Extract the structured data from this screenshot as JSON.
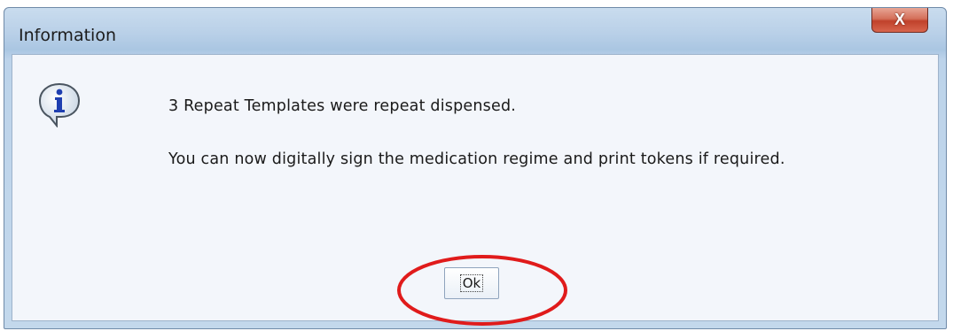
{
  "dialog": {
    "title": "Information",
    "close_icon": "close-icon",
    "close_label": "X",
    "icon": "information-icon",
    "message_line1": "3 Repeat Templates were repeat dispensed.",
    "message_line2": "You can now digitally sign the medication regime and print tokens if required.",
    "ok_label": "Ok"
  },
  "annotation": {
    "shape": "ellipse",
    "color": "#e01b1b",
    "target": "ok-button"
  }
}
